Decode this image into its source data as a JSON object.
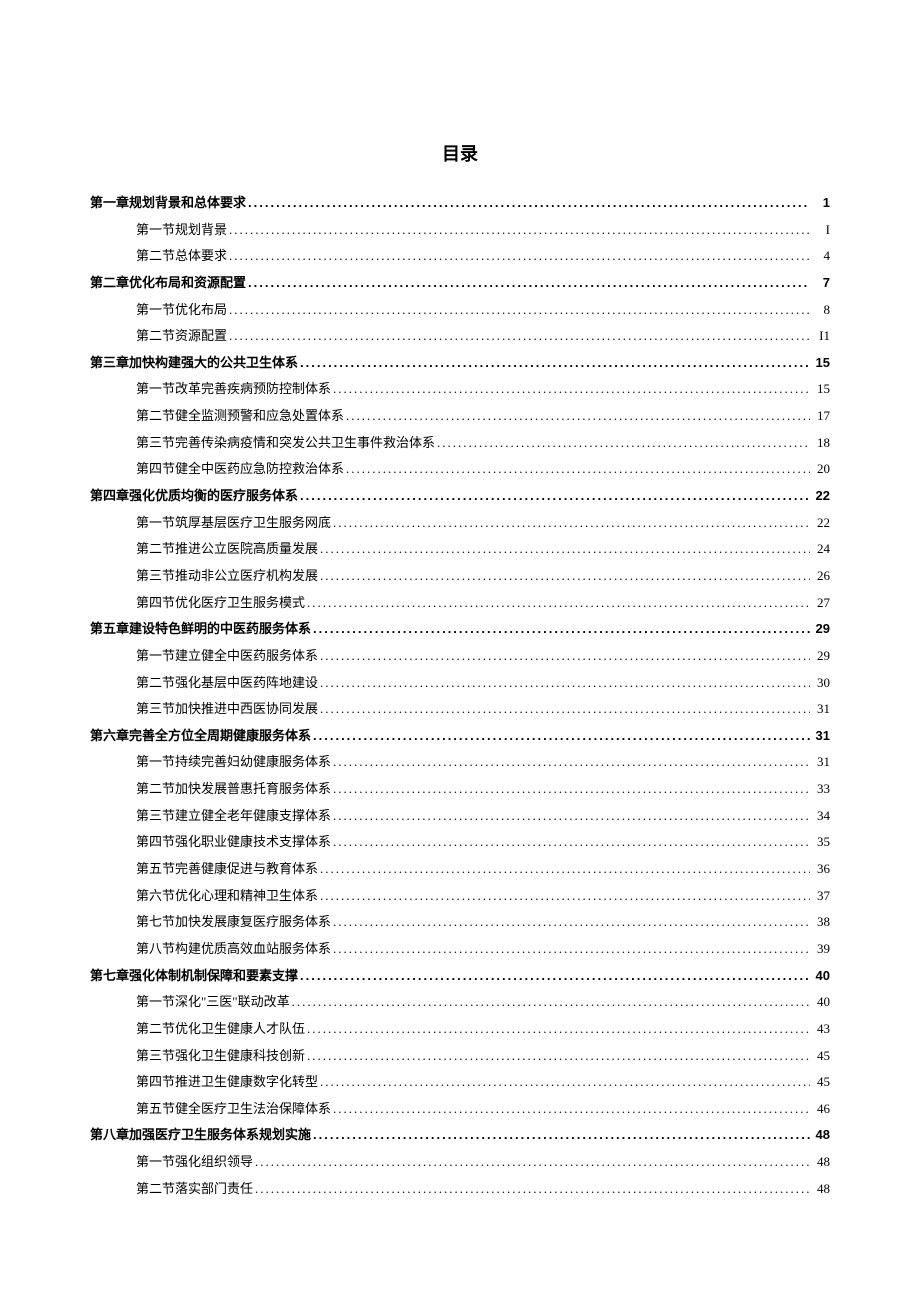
{
  "title": "目录",
  "toc": [
    {
      "type": "chapter",
      "label": "第一章规划背景和总体要求",
      "page": "1"
    },
    {
      "type": "section",
      "label": "第一节规划背景",
      "page": "I"
    },
    {
      "type": "section",
      "label": "第二节总体要求",
      "page": "4"
    },
    {
      "type": "chapter",
      "label": "第二章优化布局和资源配置",
      "page": "7"
    },
    {
      "type": "section",
      "label": "第一节优化布局",
      "page": "8"
    },
    {
      "type": "section",
      "label": "第二节资源配置",
      "page": "I1"
    },
    {
      "type": "chapter",
      "label": "第三章加快构建强大的公共卫生体系",
      "page": "15"
    },
    {
      "type": "section",
      "label": "第一节改革完善疾病预防控制体系",
      "page": "15"
    },
    {
      "type": "section",
      "label": "第二节健全监测预警和应急处置体系",
      "page": "17"
    },
    {
      "type": "section",
      "label": "第三节完善传染病疫情和突发公共卫生事件救治体系",
      "page": "18"
    },
    {
      "type": "section",
      "label": "第四节健全中医药应急防控救治体系",
      "page": "20"
    },
    {
      "type": "chapter",
      "label": "第四章强化优质均衡的医疗服务体系",
      "page": "22"
    },
    {
      "type": "section",
      "label": "第一节筑厚基层医疗卫生服务网底",
      "page": "22"
    },
    {
      "type": "section",
      "label": "第二节推进公立医院高质量发展",
      "page": "24"
    },
    {
      "type": "section",
      "label": "第三节推动非公立医疗机构发展",
      "page": "26"
    },
    {
      "type": "section",
      "label": "第四节优化医疗卫生服务模式",
      "page": "27"
    },
    {
      "type": "chapter",
      "label": "第五章建设特色鲜明的中医药服务体系",
      "page": "29"
    },
    {
      "type": "section",
      "label": "第一节建立健全中医药服务体系",
      "page": "29"
    },
    {
      "type": "section",
      "label": "第二节强化基层中医药阵地建设",
      "page": "30"
    },
    {
      "type": "section",
      "label": "第三节加快推进中西医协同发展",
      "page": "31"
    },
    {
      "type": "chapter",
      "label": "第六章完善全方位全周期健康服务体系",
      "page": "31"
    },
    {
      "type": "section",
      "label": "第一节持续完善妇幼健康服务体系",
      "page": "31"
    },
    {
      "type": "section",
      "label": "第二节加快发展普惠托育服务体系",
      "page": "33"
    },
    {
      "type": "section",
      "label": "第三节建立健全老年健康支撑体系",
      "page": "34"
    },
    {
      "type": "section",
      "label": "第四节强化职业健康技术支撑体系",
      "page": "35"
    },
    {
      "type": "section",
      "label": "第五节完善健康促进与教育体系",
      "page": "36"
    },
    {
      "type": "section",
      "label": "第六节优化心理和精神卫生体系",
      "page": "37"
    },
    {
      "type": "section",
      "label": "第七节加快发展康复医疗服务体系",
      "page": "38"
    },
    {
      "type": "section",
      "label": "第八节构建优质高效血站服务体系",
      "page": "39"
    },
    {
      "type": "chapter",
      "label": "第七章强化体制机制保障和要素支撑",
      "page": "40"
    },
    {
      "type": "section",
      "label": "第一节深化\"三医\"联动改革",
      "page": "40"
    },
    {
      "type": "section",
      "label": "第二节优化卫生健康人才队伍",
      "page": "43"
    },
    {
      "type": "section",
      "label": "第三节强化卫生健康科技创新",
      "page": "45"
    },
    {
      "type": "section",
      "label": "第四节推进卫生健康数字化转型",
      "page": "45"
    },
    {
      "type": "section",
      "label": "第五节健全医疗卫生法治保障体系",
      "page": "46"
    },
    {
      "type": "chapter",
      "label": "第八章加强医疗卫生服务体系规划实施",
      "page": "48"
    },
    {
      "type": "section",
      "label": "第一节强化组织领导",
      "page": "48"
    },
    {
      "type": "section",
      "label": "第二节落实部门责任",
      "page": "48"
    }
  ]
}
